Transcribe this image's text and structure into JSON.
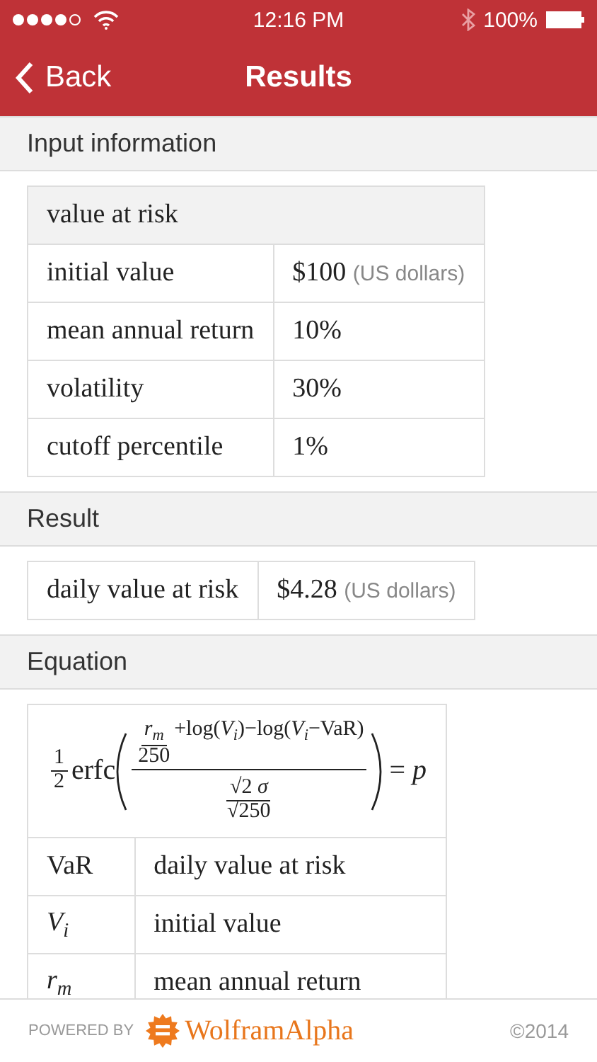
{
  "status_bar": {
    "time": "12:16 PM",
    "battery": "100%"
  },
  "nav": {
    "back": "Back",
    "title": "Results"
  },
  "sections": [
    {
      "kind": "table",
      "title": "Input information",
      "header": "value at risk",
      "rows": [
        {
          "label": "initial value",
          "value": "$100",
          "unit": "(US dollars)"
        },
        {
          "label": "mean annual return",
          "value": "10%"
        },
        {
          "label": "volatility",
          "value": "30%"
        },
        {
          "label": "cutoff percentile",
          "value": "1%"
        }
      ]
    },
    {
      "kind": "result",
      "title": "Result",
      "label": "daily value at risk",
      "value": "$4.28",
      "unit": "(US dollars)"
    },
    {
      "kind": "equation",
      "title": "Equation",
      "formula": {
        "coef_num": "1",
        "coef_den": "2",
        "func": "erfc",
        "frac_num": "*r*$_{m}$",
        "frac_den": "250",
        "num_rest": "+log(*V*$_{i}$)−log(*V*$_{i}$−VaR)",
        "den_num": "√2 *σ*",
        "den_den": "√250",
        "rhs": "= *p*"
      },
      "variables": [
        {
          "symbol": "VaR",
          "meaning": "daily value at risk"
        },
        {
          "symbol": "*V*$_{i}$",
          "meaning": "initial value"
        },
        {
          "symbol": "*r*$_{m}$",
          "meaning": "mean annual return"
        }
      ]
    }
  ],
  "footer": {
    "powered": "POWERED BY",
    "brand": "WolframAlpha",
    "copyright": "©2014"
  }
}
